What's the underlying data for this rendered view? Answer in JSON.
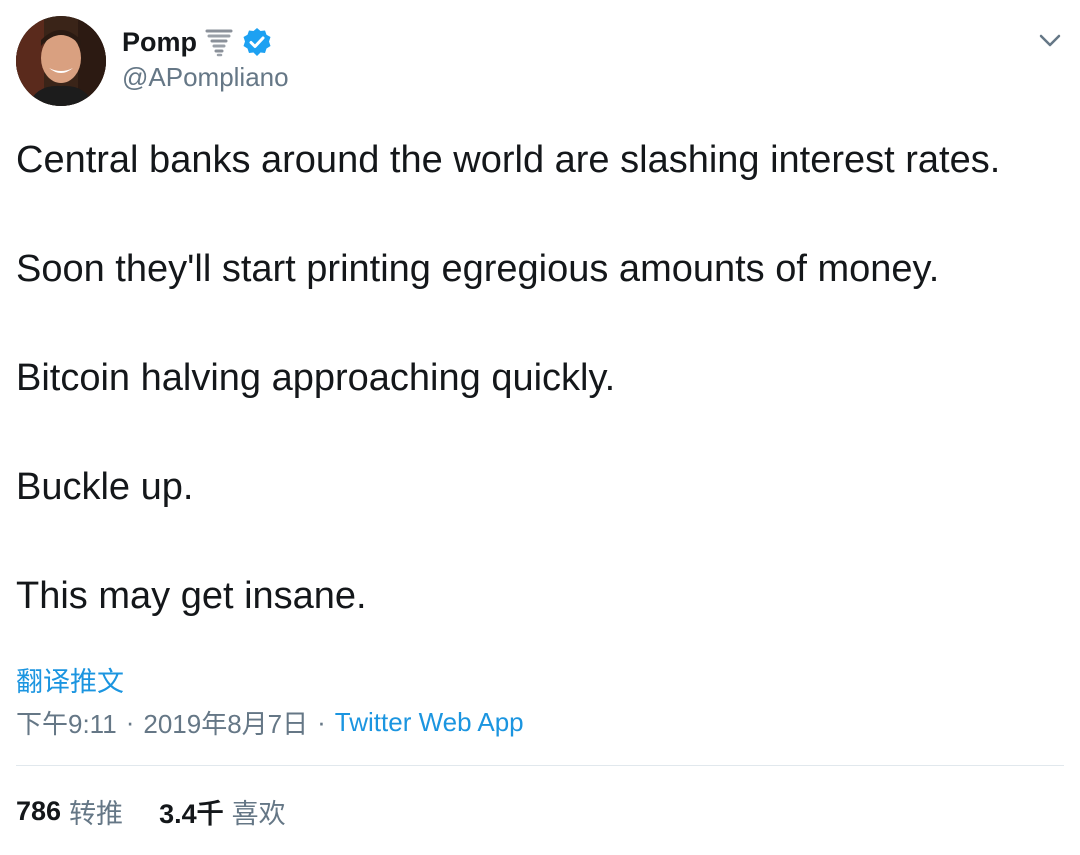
{
  "header": {
    "display_name": "Pomp",
    "handle": "@APompliano",
    "icons": {
      "name_emoji": "tornado-icon",
      "verified": "verified-badge-icon",
      "menu": "chevron-down-icon"
    }
  },
  "tweet": {
    "lines": [
      "Central banks around the world are slashing interest rates.",
      "Soon they'll start printing egregious amounts of money.",
      "Bitcoin halving approaching quickly.",
      "Buckle up.",
      "This may get insane."
    ],
    "translate_label": "翻译推文"
  },
  "meta": {
    "time": "下午9:11",
    "separator": "·",
    "date": "2019年8月7日",
    "source": "Twitter Web App"
  },
  "stats": {
    "retweets_count": "786",
    "retweets_label": "转推",
    "likes_count": "3.4千",
    "likes_label": "喜欢"
  },
  "colors": {
    "text": "#14171a",
    "secondary": "#657786",
    "link": "#1b95e0",
    "divider": "#e1e8ed"
  }
}
